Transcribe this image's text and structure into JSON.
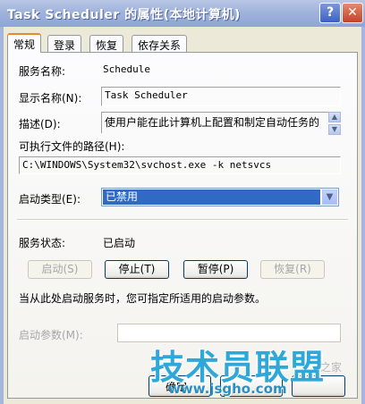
{
  "window": {
    "title": "Task Scheduler 的属性(本地计算机)",
    "help_label": "?",
    "close_label": "✕"
  },
  "tabs": [
    {
      "label": "常规"
    },
    {
      "label": "登录"
    },
    {
      "label": "恢复"
    },
    {
      "label": "依存关系"
    }
  ],
  "general": {
    "service_name_label": "服务名称:",
    "service_name_value": "Schedule",
    "display_name_label": "显示名称(N):",
    "display_name_value": "Task Scheduler",
    "description_label": "描述(D):",
    "description_value": "使用户能在此计算机上配置和制定自动任务的",
    "exe_path_label": "可执行文件的路径(H):",
    "exe_path_value": "C:\\WINDOWS\\System32\\svchost.exe -k netsvcs",
    "startup_type_label": "启动类型(E):",
    "startup_type_value": "已禁用",
    "status_label": "服务状态:",
    "status_value": "已启动",
    "buttons": {
      "start": "启动(S)",
      "stop": "停止(T)",
      "pause": "暂停(P)",
      "resume": "恢复(R)"
    },
    "hint_text": "当从此处启动服务时，您可指定所适用的启动参数。",
    "start_params_label": "启动参数(M):",
    "start_params_value": ""
  },
  "footer": {
    "ok_label": "确定"
  },
  "watermark": {
    "title": "技术员联盟",
    "url": "www.jsgho.com",
    "faint": "之家"
  },
  "colors": {
    "selection": "#316ac5",
    "tab_accent": "#e68b2c",
    "watermark": "#2fa7d8"
  }
}
